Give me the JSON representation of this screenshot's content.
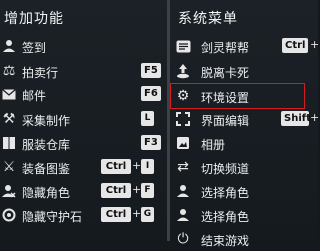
{
  "left": {
    "title": "增加功能",
    "items": [
      {
        "label": "签到",
        "icon": "person-icon",
        "keys": []
      },
      {
        "label": "拍卖行",
        "icon": "scales-icon",
        "keys": [
          "F5"
        ]
      },
      {
        "label": "邮件",
        "icon": "envelope-icon",
        "keys": [
          "F6"
        ]
      },
      {
        "label": "采集制作",
        "icon": "hammer-icon",
        "keys": [
          "L"
        ]
      },
      {
        "label": "服装仓库",
        "icon": "wardrobe-icon",
        "keys": [
          "F3"
        ]
      },
      {
        "label": "装备图鉴",
        "icon": "equipment-icon",
        "keys": [
          "Ctrl",
          "I"
        ]
      },
      {
        "label": "隐藏角色",
        "icon": "hide-person-icon",
        "keys": [
          "Ctrl",
          "F"
        ]
      },
      {
        "label": "隐藏守护石",
        "icon": "hide-stone-icon",
        "keys": [
          "Ctrl",
          "G"
        ]
      }
    ]
  },
  "right": {
    "title": "系统菜单",
    "items": [
      {
        "label": "剑灵帮帮",
        "icon": "help-list-icon",
        "keys": [
          "Ctrl",
          "+"
        ]
      },
      {
        "label": "脱离卡死",
        "icon": "unstuck-icon",
        "keys": []
      },
      {
        "label": "环境设置",
        "icon": "gear-icon",
        "keys": []
      },
      {
        "label": "界面编辑",
        "icon": "layout-edit-icon",
        "keys": [
          "Shift",
          "+"
        ]
      },
      {
        "label": "相册",
        "icon": "album-icon",
        "keys": []
      },
      {
        "label": "切换频道",
        "icon": "switch-channel-icon",
        "keys": []
      },
      {
        "label": "选择角色",
        "icon": "person-icon",
        "keys": []
      },
      {
        "label": "选择角色",
        "icon": "person-icon",
        "keys": []
      },
      {
        "label": "结束游戏",
        "icon": "power-icon",
        "keys": []
      }
    ]
  },
  "highlight_color": "#d01c1c"
}
